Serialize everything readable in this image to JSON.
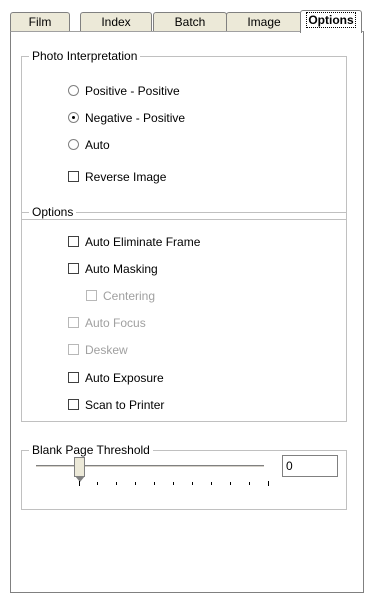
{
  "tabs": [
    {
      "label": "Film",
      "active": false
    },
    {
      "label": "Index",
      "active": false
    },
    {
      "label": "Batch",
      "active": false
    },
    {
      "label": "Image",
      "active": false
    },
    {
      "label": "Options",
      "active": true
    }
  ],
  "photo_interpretation": {
    "title": "Photo Interpretation",
    "options": [
      {
        "label": "Positive - Positive",
        "selected": false
      },
      {
        "label": "Negative - Positive",
        "selected": true
      },
      {
        "label": "Auto",
        "selected": false
      }
    ],
    "reverse_image": {
      "label": "Reverse Image",
      "checked": false
    }
  },
  "options": {
    "title": "Options",
    "items": [
      {
        "label": "Auto Eliminate Frame",
        "checked": false,
        "enabled": true
      },
      {
        "label": "Auto Masking",
        "checked": false,
        "enabled": true
      },
      {
        "label": "Centering",
        "checked": false,
        "enabled": false
      },
      {
        "label": "Auto Focus",
        "checked": false,
        "enabled": false
      },
      {
        "label": "Deskew",
        "checked": false,
        "enabled": false
      },
      {
        "label": "Auto Exposure",
        "checked": false,
        "enabled": true
      },
      {
        "label": "Scan to Printer",
        "checked": false,
        "enabled": true
      }
    ]
  },
  "blank_page_threshold": {
    "title": "Blank Page Threshold",
    "value": "0",
    "slider_fraction": 0
  }
}
